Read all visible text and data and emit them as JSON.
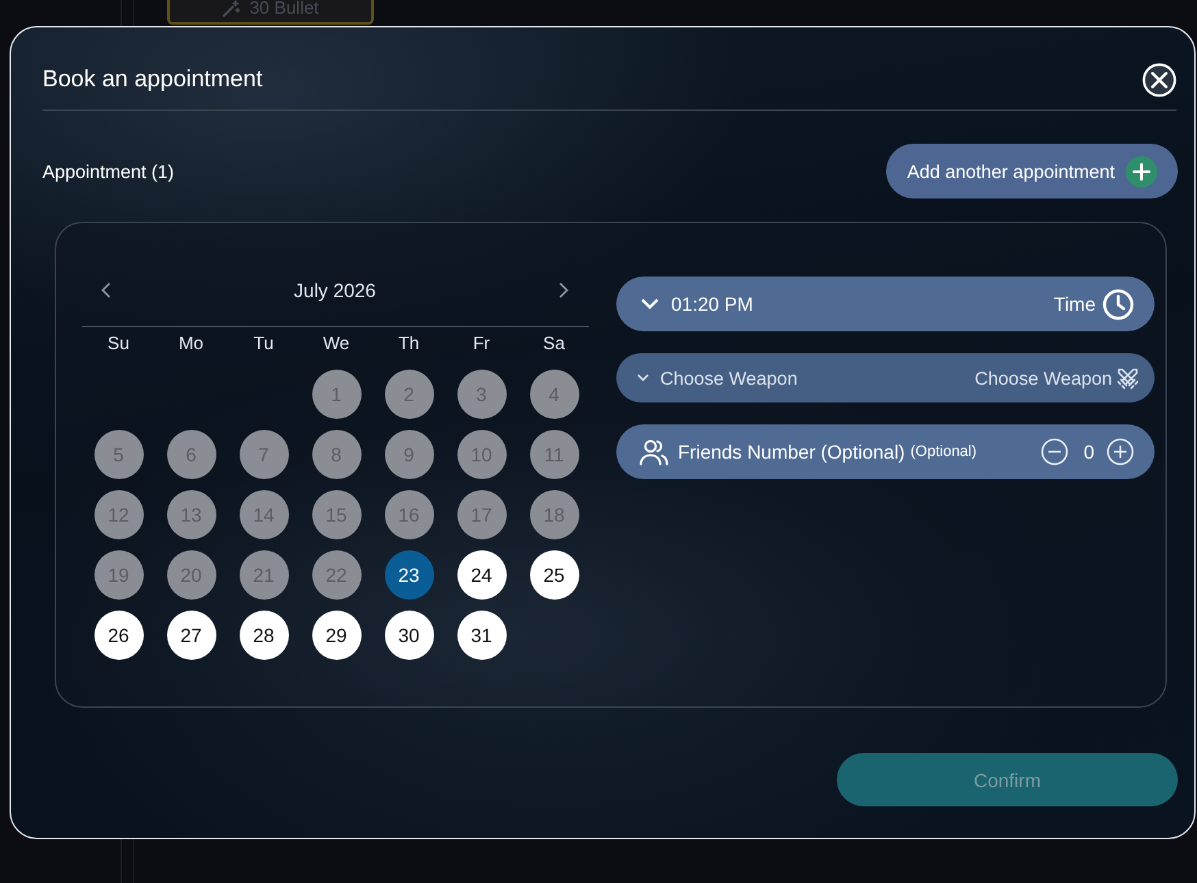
{
  "backdrop": {
    "card": {
      "label": "30 Bullet"
    }
  },
  "dialog": {
    "title": "Book an appointment"
  },
  "appointment": {
    "label": "Appointment (1)",
    "add_button": "Add another appointment"
  },
  "calendar": {
    "month": "July 2026",
    "weekdays": [
      "Su",
      "Mo",
      "Tu",
      "We",
      "Th",
      "Fr",
      "Sa"
    ],
    "weeks": [
      {
        "days": [
          {
            "label": "1",
            "disabled": true,
            "selected": false
          },
          {
            "label": "2",
            "disabled": true,
            "selected": false
          },
          {
            "label": "3",
            "disabled": true,
            "selected": false
          },
          {
            "label": "4",
            "disabled": true,
            "selected": false
          }
        ]
      },
      {
        "days": [
          {
            "label": "5",
            "disabled": true,
            "selected": false
          },
          {
            "label": "6",
            "disabled": true,
            "selected": false
          },
          {
            "label": "7",
            "disabled": true,
            "selected": false
          },
          {
            "label": "8",
            "disabled": true,
            "selected": false
          },
          {
            "label": "9",
            "disabled": true,
            "selected": false
          },
          {
            "label": "10",
            "disabled": true,
            "selected": false
          },
          {
            "label": "11",
            "disabled": true,
            "selected": false
          }
        ]
      },
      {
        "days": [
          {
            "label": "12",
            "disabled": true,
            "selected": false
          },
          {
            "label": "13",
            "disabled": true,
            "selected": false
          },
          {
            "label": "14",
            "disabled": true,
            "selected": false
          },
          {
            "label": "15",
            "disabled": true,
            "selected": false
          },
          {
            "label": "16",
            "disabled": true,
            "selected": false
          },
          {
            "label": "17",
            "disabled": true,
            "selected": false
          },
          {
            "label": "18",
            "disabled": true,
            "selected": false
          }
        ]
      },
      {
        "days": [
          {
            "label": "19",
            "disabled": true,
            "selected": false
          },
          {
            "label": "20",
            "disabled": true,
            "selected": false
          },
          {
            "label": "21",
            "disabled": true,
            "selected": false
          },
          {
            "label": "22",
            "disabled": true,
            "selected": false
          },
          {
            "label": "23",
            "disabled": false,
            "selected": true
          },
          {
            "label": "24",
            "disabled": false,
            "selected": false
          },
          {
            "label": "25",
            "disabled": false,
            "selected": false
          }
        ]
      },
      {
        "days": [
          {
            "label": "26",
            "disabled": false,
            "selected": false
          },
          {
            "label": "27",
            "disabled": false,
            "selected": false
          },
          {
            "label": "28",
            "disabled": false,
            "selected": false
          },
          {
            "label": "29",
            "disabled": false,
            "selected": false
          },
          {
            "label": "30",
            "disabled": false,
            "selected": false
          },
          {
            "label": "31",
            "disabled": false,
            "selected": false
          }
        ]
      }
    ]
  },
  "fields": [
    {
      "kind": "time",
      "value": "01:20 PM",
      "label": "Time"
    },
    {
      "kind": "weapon",
      "placeholder": "Choose Weapon",
      "label": "Choose Weapon"
    },
    {
      "kind": "friends",
      "label": "Friends Number (Optional)",
      "note": "(Optional)",
      "count": "0"
    }
  ],
  "confirm": {
    "label": "Confirm",
    "disabled": true
  }
}
